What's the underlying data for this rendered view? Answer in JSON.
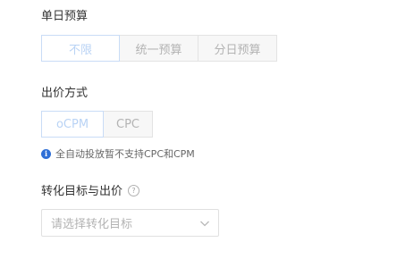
{
  "daily_budget": {
    "label": "单日预算",
    "options": [
      "不限",
      "统一预算",
      "分日预算"
    ],
    "selected": "不限"
  },
  "bid_method": {
    "label": "出价方式",
    "options": [
      "oCPM",
      "CPC"
    ],
    "selected": "oCPM",
    "hint": "全自动投放暂不支持CPC和CPM"
  },
  "conversion": {
    "label": "转化目标与出价",
    "help_icon": "question-circle-icon",
    "select_placeholder": "请选择转化目标",
    "select_icon": "chevron-down-icon"
  },
  "colors": {
    "accent": "#2f6fd6",
    "active_text": "#b9d3f5",
    "inactive_bg": "#f7f7f7"
  }
}
